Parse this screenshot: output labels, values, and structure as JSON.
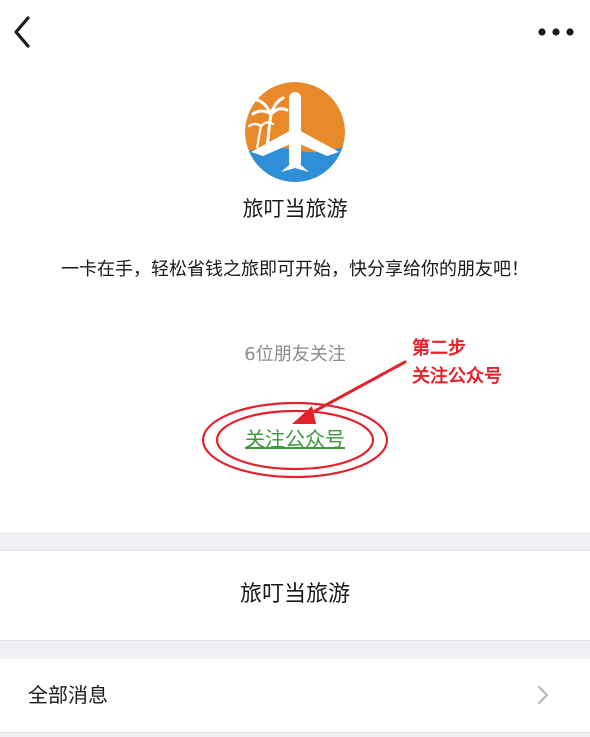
{
  "top_bar": {
    "back_icon": "chevron-left-icon",
    "more_icon": "more-horizontal-icon"
  },
  "profile": {
    "avatar_icon": "airplane-logo-icon",
    "name": "旅叮当旅游",
    "intro": "一卡在手，轻松省钱之旅即可开始，快分享给你的朋友吧！",
    "friends_following": "6位朋友关注",
    "follow_label": "关注公众号"
  },
  "annotation": {
    "step": "第二步",
    "action": "关注公众号",
    "color": "#e4222b"
  },
  "card": {
    "title": "旅叮当旅游"
  },
  "menu": {
    "all_messages": "全部消息",
    "chevron_icon": "chevron-right-icon"
  },
  "colors": {
    "link_green": "#3c9a3c",
    "avatar_orange": "#e88a2a",
    "avatar_blue": "#2f8fd6",
    "separator_gray": "#efeff4"
  }
}
